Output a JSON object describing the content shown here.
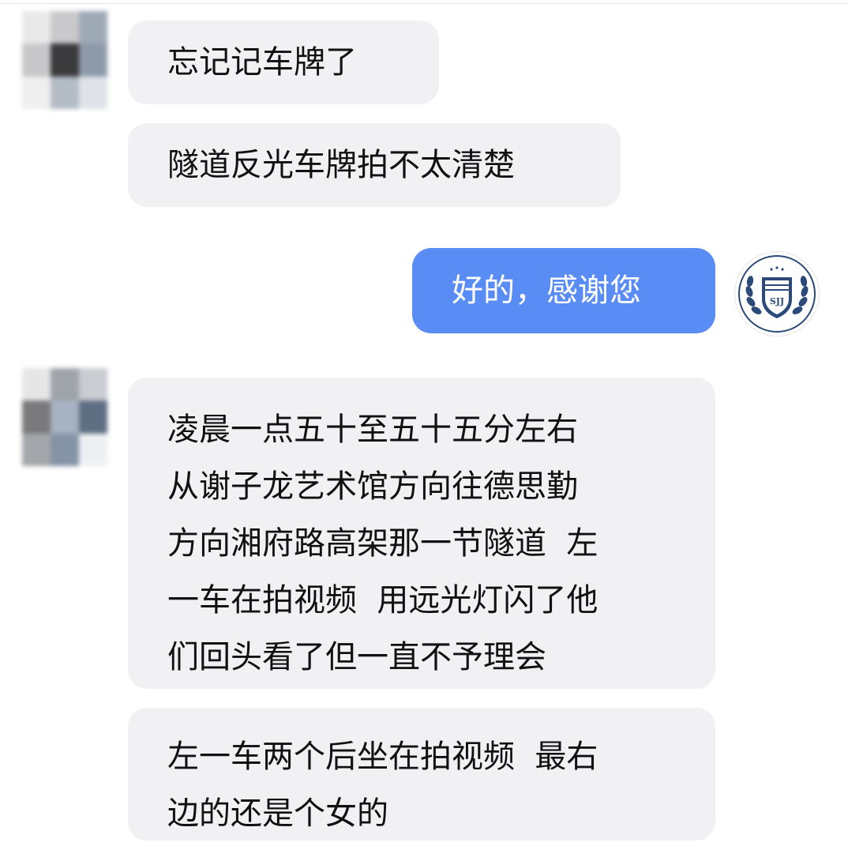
{
  "colors": {
    "incoming_bubble": "#f1f1f3",
    "outgoing_bubble": "#5a8cf5",
    "text_dark": "#111111",
    "text_light": "#ffffff"
  },
  "badge": {
    "text": "SJJ"
  },
  "messages": [
    {
      "sender": "other",
      "lines": [
        "忘记记车牌了"
      ]
    },
    {
      "sender": "other",
      "lines": [
        "隧道反光车牌拍不太清楚"
      ]
    },
    {
      "sender": "me",
      "lines": [
        "好的，感谢您"
      ]
    },
    {
      "sender": "other",
      "lines": [
        "凌晨一点五十至五十五分左右",
        "从谢子龙艺术馆方向往德思勤",
        "方向湘府路高架那一节隧道  左",
        "一车在拍视频  用远光灯闪了他",
        "们回头看了但一直不予理会"
      ]
    },
    {
      "sender": "other",
      "lines": [
        "左一车两个后坐在拍视频  最右",
        "边的还是个女的"
      ]
    }
  ]
}
